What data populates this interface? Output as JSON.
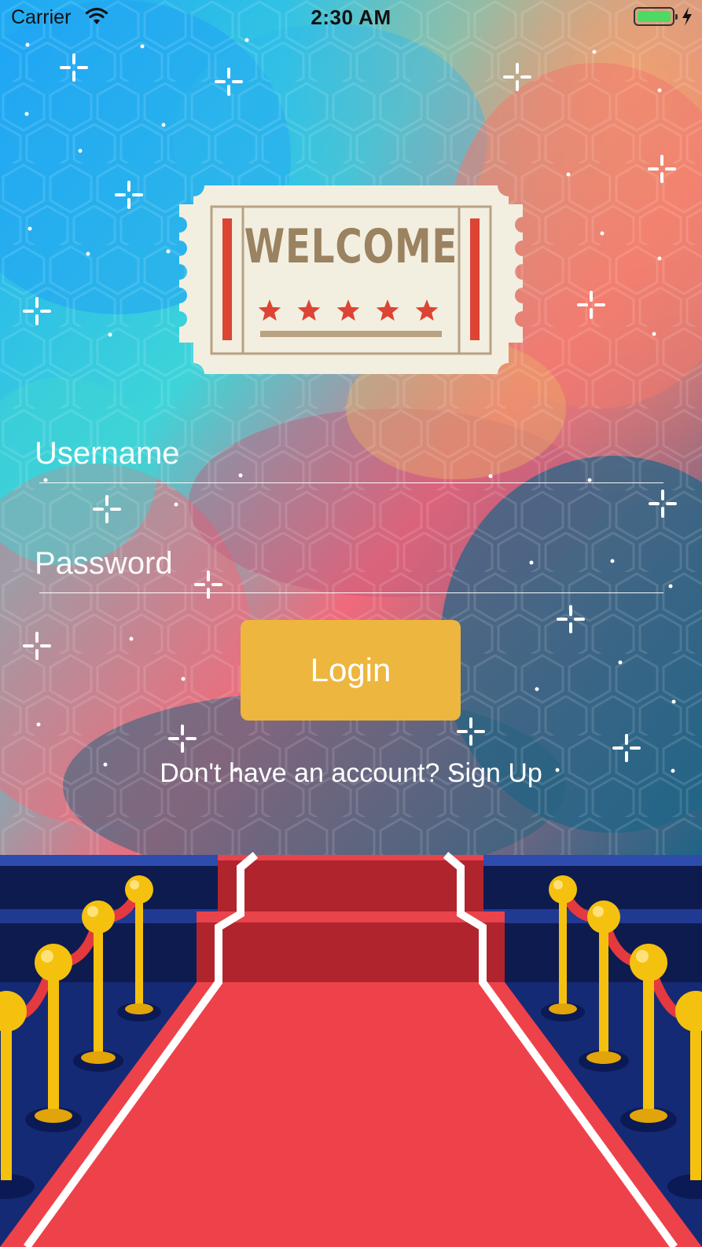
{
  "status_bar": {
    "carrier": "Carrier",
    "time": "2:30 AM",
    "battery_color": "#4cd964"
  },
  "hero": {
    "ticket_text": "WELCOME",
    "star_count": 5,
    "ticket_color": "#f2efe1",
    "ticket_accent": "#dc4434"
  },
  "form": {
    "username_placeholder": "Username",
    "password_placeholder": "Password",
    "login_label": "Login",
    "signup_prompt": "Don't have an account?",
    "signup_link": "Sign Up"
  },
  "colors": {
    "login_button": "#edb63e",
    "carpet": "#ee424b",
    "stanchion": "#f5c10f",
    "backdrop": "#162a72"
  }
}
